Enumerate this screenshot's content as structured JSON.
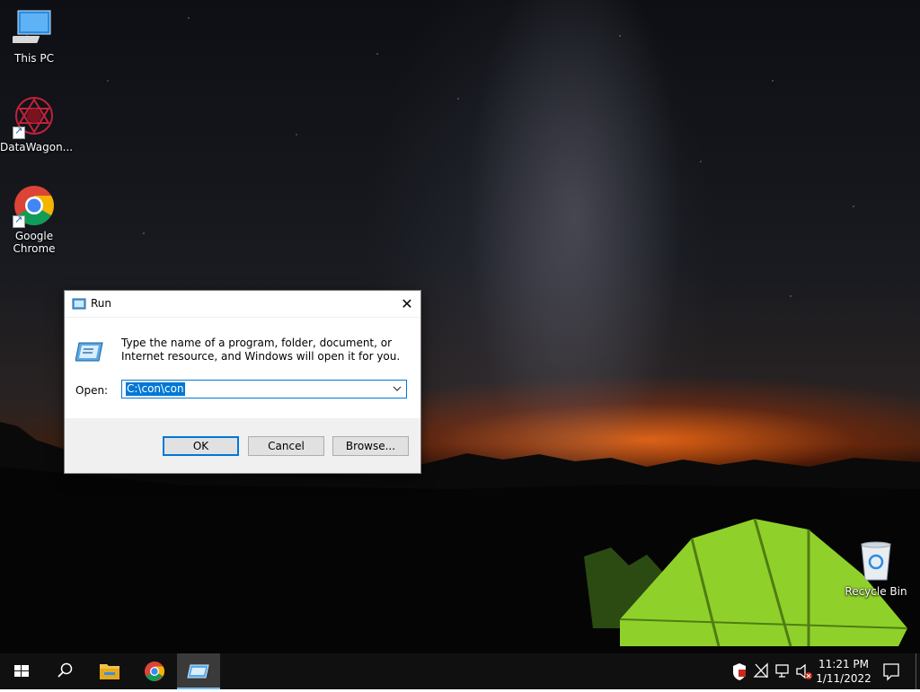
{
  "desktop": {
    "icons": [
      {
        "label": "This PC"
      },
      {
        "label": "DataWagon..."
      },
      {
        "label_line1": "Google",
        "label_line2": "Chrome"
      },
      {
        "label": "Recycle Bin"
      }
    ]
  },
  "run_dialog": {
    "title": "Run",
    "close_glyph": "✕",
    "description": "Type the name of a program, folder, document, or Internet resource, and Windows will open it for you.",
    "open_label": "Open:",
    "open_value": "C:\\con\\con",
    "buttons": {
      "ok": "OK",
      "cancel": "Cancel",
      "browse": "Browse..."
    }
  },
  "taskbar": {
    "pinned": [
      "start-icon",
      "search-icon",
      "file-explorer-icon",
      "chrome-icon",
      "run-icon"
    ],
    "tray_icons": [
      "security-icon",
      "network-disconnected-icon",
      "display-icon",
      "volume-muted-icon"
    ],
    "time": "11:21 PM",
    "date": "1/11/2022"
  },
  "colors": {
    "accent": "#0078d7",
    "taskbar": "#101010",
    "tent": "#8fd12a"
  }
}
